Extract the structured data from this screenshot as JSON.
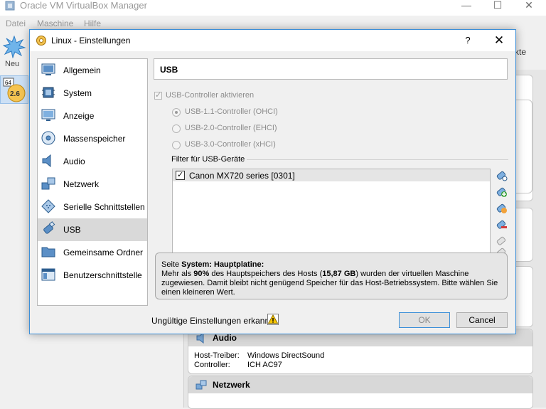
{
  "main_window": {
    "title": "Oracle VM VirtualBox Manager",
    "menu": [
      "Datei",
      "Maschine",
      "Hilfe"
    ],
    "toolbar_new_label": "Neu",
    "toolbar_right_text": "kte",
    "vm_item": {
      "badge_top": "64",
      "badge_version": "2.6"
    },
    "details": {
      "audio": {
        "title": "Audio",
        "rows": [
          {
            "key": "Host-Treiber:",
            "value": "Windows DirectSound"
          },
          {
            "key": "Controller:",
            "value": "ICH AC97"
          }
        ]
      },
      "network": {
        "title": "Netzwerk"
      }
    }
  },
  "dialog": {
    "title": "Linux - Einstellungen",
    "help_label": "?",
    "close_label": "✕",
    "nav": [
      {
        "label": "Allgemein",
        "icon": "general-icon"
      },
      {
        "label": "System",
        "icon": "system-icon"
      },
      {
        "label": "Anzeige",
        "icon": "display-icon"
      },
      {
        "label": "Massenspeicher",
        "icon": "storage-icon"
      },
      {
        "label": "Audio",
        "icon": "audio-icon"
      },
      {
        "label": "Netzwerk",
        "icon": "network-icon"
      },
      {
        "label": "Serielle Schnittstellen",
        "icon": "serial-ports-icon"
      },
      {
        "label": "USB",
        "icon": "usb-icon",
        "selected": true
      },
      {
        "label": "Gemeinsame Ordner",
        "icon": "shared-folders-icon"
      },
      {
        "label": "Benutzerschnittstelle",
        "icon": "user-interface-icon"
      }
    ],
    "page_title": "USB",
    "usb_enable": {
      "label": "USB-Controller aktivieren",
      "checked": true,
      "disabled": true
    },
    "usb_versions": [
      {
        "label": "USB-1.1-Controller (OHCI)",
        "checked": true
      },
      {
        "label": "USB-2.0-Controller (EHCI)",
        "checked": false
      },
      {
        "label": "USB-3.0-Controller (xHCI)",
        "checked": false
      }
    ],
    "filter_label": "Filter für USB-Geräte",
    "filters": [
      {
        "label": "Canon MX720 series [0301]",
        "checked": true
      }
    ],
    "warning": {
      "prefix": "Seite ",
      "page_name": "System: Hauptplatine",
      "colon": ":",
      "line_a": "Mehr als ",
      "percent": "90%",
      "line_b": " des Hauptspeichers des Hosts (",
      "amount": "15,87 GB",
      "line_c": ") wurden der virtuellen Maschine zugewiesen. Damit bleibt nicht genügend Speicher für das Host-Betriebssystem. Bitte wählen Sie einen kleineren Wert."
    },
    "invalid_settings_label": "Ungültige Einstellungen erkannt",
    "ok_label": "OK",
    "cancel_label": "Cancel"
  }
}
